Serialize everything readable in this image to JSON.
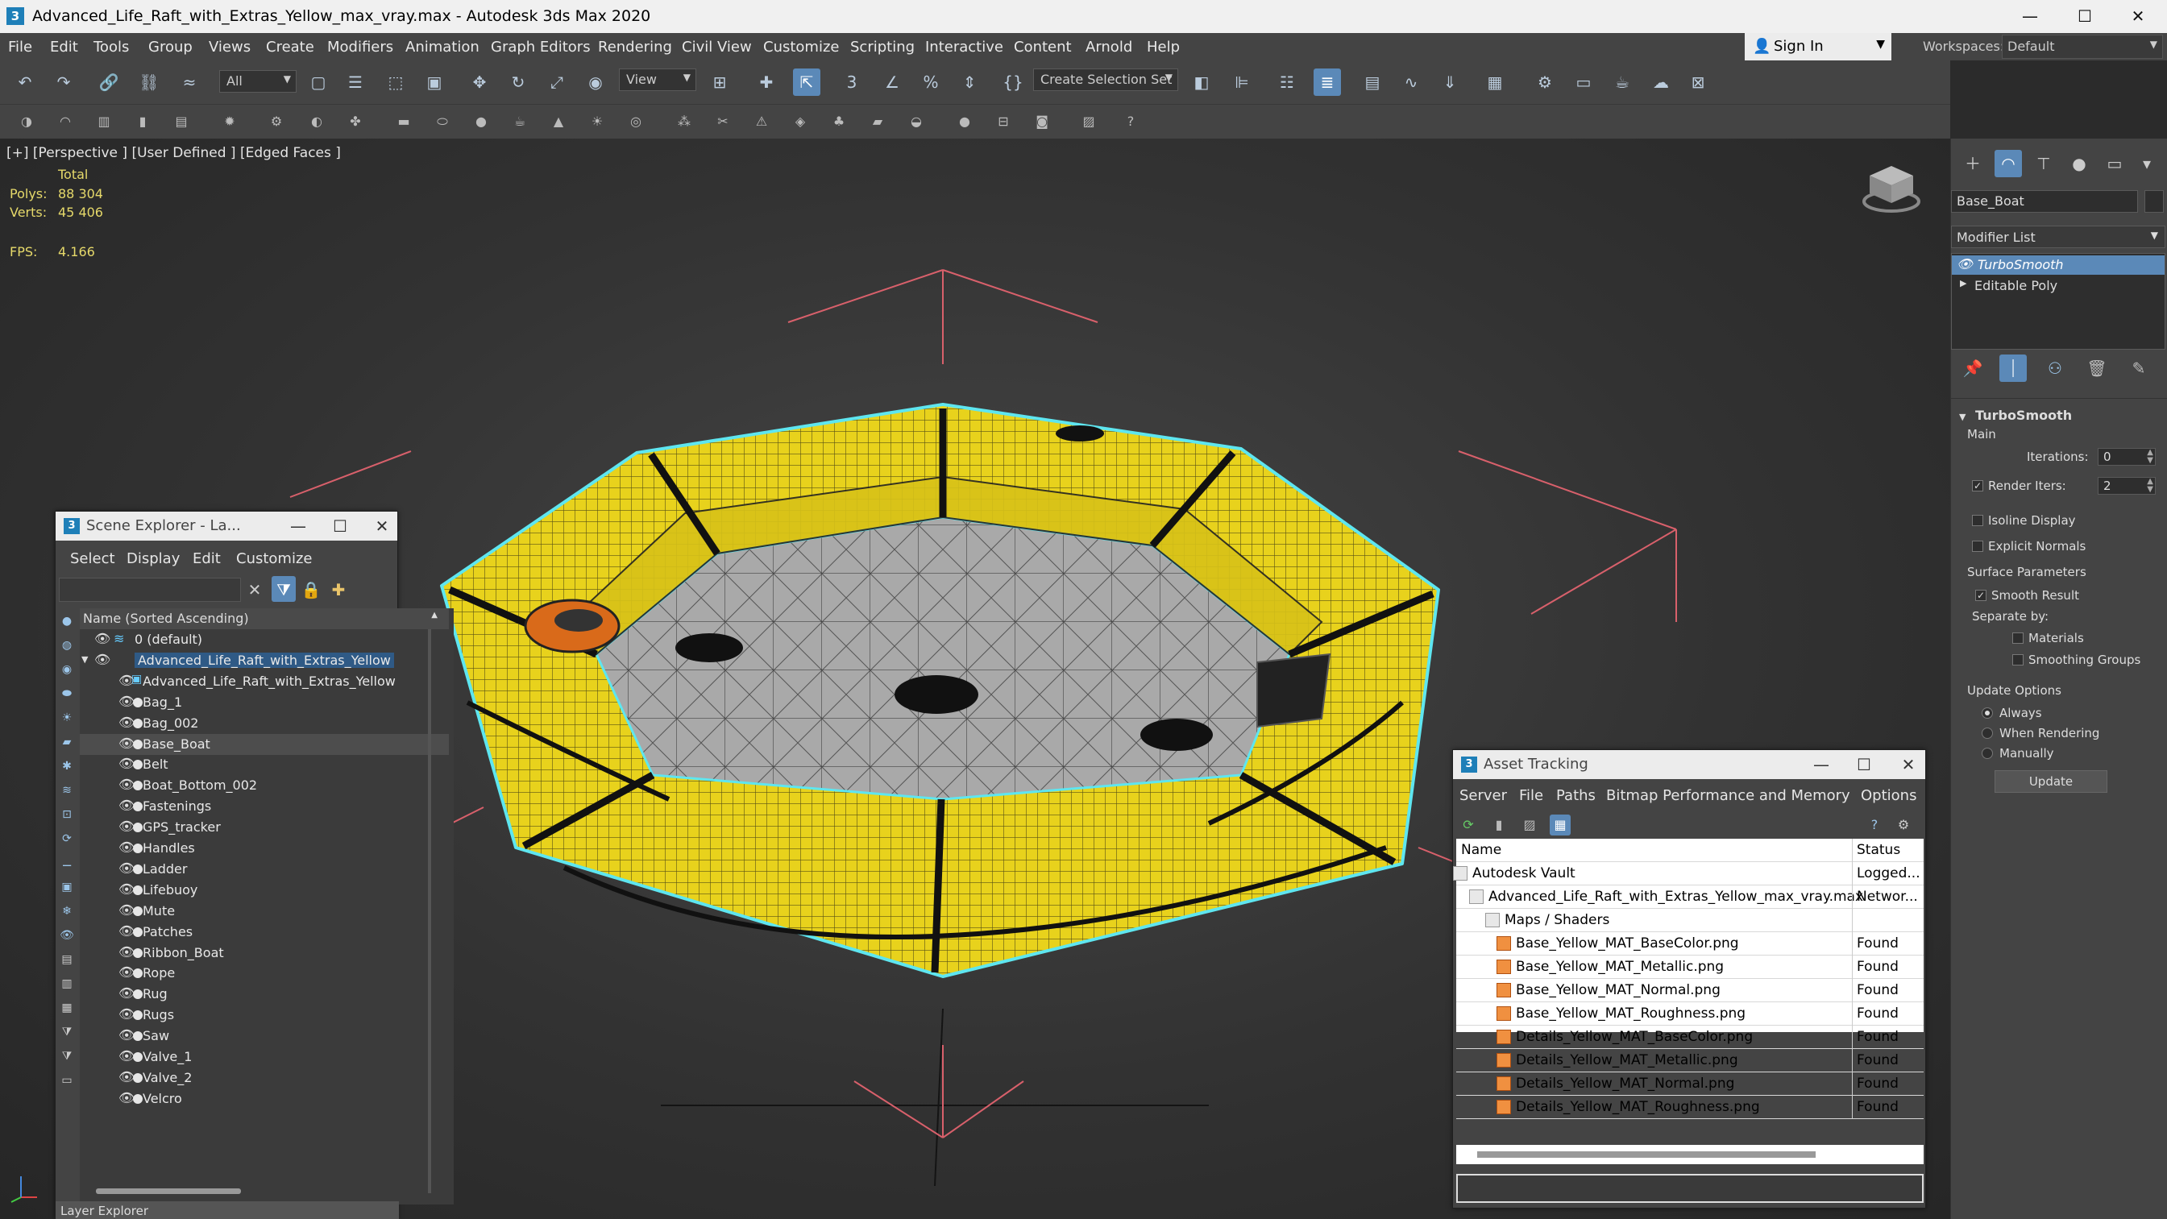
{
  "window": {
    "title": "Advanced_Life_Raft_with_Extras_Yellow_max_vray.max - Autodesk 3ds Max 2020",
    "app_icon_glyph": "3",
    "minimize_glyph": "—",
    "maximize_glyph": "☐",
    "close_glyph": "✕"
  },
  "menu": [
    "File",
    "Edit",
    "Tools",
    "Group",
    "Views",
    "Create",
    "Modifiers",
    "Animation",
    "Graph Editors",
    "Rendering",
    "Civil View",
    "Customize",
    "Scripting",
    "Interactive",
    "Content",
    "Arnold",
    "Help"
  ],
  "account": {
    "sign_in": "Sign In",
    "workspaces_label": "Workspaces:",
    "workspace": "Default"
  },
  "toolbar": {
    "filter_dropdown": "All",
    "ref_coord_dropdown": "View",
    "selection_set_dropdown": "Create Selection Set",
    "snap_labels": [
      "3",
      "%"
    ]
  },
  "viewport": {
    "label": "[+] [Perspective ] [User Defined ] [Edged Faces ]",
    "stats_header": "Total",
    "polys_label": "Polys:",
    "polys_value": "88 304",
    "verts_label": "Verts:",
    "verts_value": "45 406",
    "fps_label": "FPS:",
    "fps_value": "4.166"
  },
  "command_panel": {
    "object_name": "Base_Boat",
    "modifier_list_label": "Modifier List",
    "stack": [
      "TurboSmooth",
      "Editable Poly"
    ],
    "rollout_title": "TurboSmooth",
    "main_label": "Main",
    "iterations_label": "Iterations:",
    "iterations_value": "0",
    "render_iters_label": "Render Iters:",
    "render_iters_value": "2",
    "isoline_label": "Isoline Display",
    "explicit_normals_label": "Explicit Normals",
    "surface_params_label": "Surface Parameters",
    "smooth_result_label": "Smooth Result",
    "separate_by_label": "Separate by:",
    "materials_label": "Materials",
    "smoothing_groups_label": "Smoothing Groups",
    "update_options_label": "Update Options",
    "always_label": "Always",
    "when_rendering_label": "When Rendering",
    "manually_label": "Manually",
    "update_button": "Update"
  },
  "scene_explorer": {
    "title": "Scene Explorer - La...",
    "menu": [
      "Select",
      "Display",
      "Edit",
      "Customize"
    ],
    "column_header": "Name (Sorted Ascending)",
    "layer_default": "0 (default)",
    "root": "Advanced_Life_Raft_with_Extras_Yellow",
    "items": [
      "Advanced_Life_Raft_with_Extras_Yellow",
      "Bag_1",
      "Bag_002",
      "Base_Boat",
      "Belt",
      "Boat_Bottom_002",
      "Fastenings",
      "GPS_tracker",
      "Handles",
      "Ladder",
      "Lifebuoy",
      "Mute",
      "Patches",
      "Ribbon_Boat",
      "Rope",
      "Rug",
      "Rugs",
      "Saw",
      "Valve_1",
      "Valve_2",
      "Velcro"
    ],
    "footer": "Layer Explorer"
  },
  "asset_tracking": {
    "title": "Asset Tracking",
    "menu": [
      "Server",
      "File",
      "Paths",
      "Bitmap Performance and Memory",
      "Options"
    ],
    "col_name": "Name",
    "col_status": "Status",
    "rows": [
      {
        "name": "Autodesk Vault",
        "status": "Logged..."
      },
      {
        "name": "Advanced_Life_Raft_with_Extras_Yellow_max_vray.max",
        "status": "Networ..."
      },
      {
        "name": "Maps / Shaders",
        "status": ""
      },
      {
        "name": "Base_Yellow_MAT_BaseColor.png",
        "status": "Found"
      },
      {
        "name": "Base_Yellow_MAT_Metallic.png",
        "status": "Found"
      },
      {
        "name": "Base_Yellow_MAT_Normal.png",
        "status": "Found"
      },
      {
        "name": "Base_Yellow_MAT_Roughness.png",
        "status": "Found"
      },
      {
        "name": "Details_Yellow_MAT_BaseColor.png",
        "status": "Found"
      },
      {
        "name": "Details_Yellow_MAT_Metallic.png",
        "status": "Found"
      },
      {
        "name": "Details_Yellow_MAT_Normal.png",
        "status": "Found"
      },
      {
        "name": "Details_Yellow_MAT_Roughness.png",
        "status": "Found"
      }
    ]
  },
  "colors": {
    "accent": "#5b89b8",
    "raft_yellow": "#e8d21c",
    "selection_cyan": "#5ee6f0",
    "stats_yellow": "#e6d96a"
  }
}
